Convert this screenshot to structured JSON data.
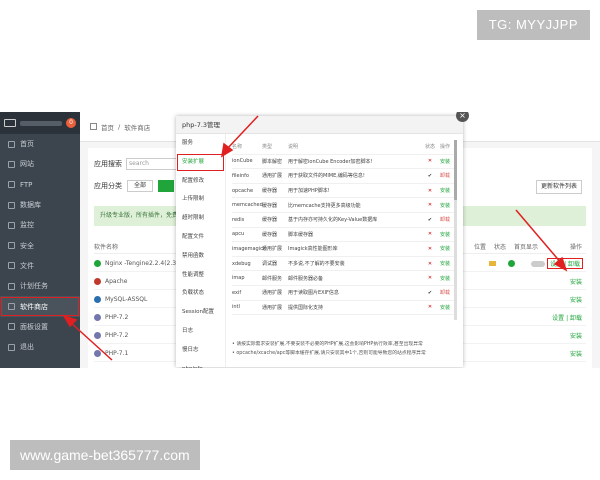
{
  "watermarks": {
    "top": "TG: MYYJJPP",
    "bottom": "www.game-bet365777.com"
  },
  "sidebar": {
    "badge": "0",
    "items": [
      {
        "label": "首页",
        "icon": "home-icon"
      },
      {
        "label": "网站",
        "icon": "globe-icon"
      },
      {
        "label": "FTP",
        "icon": "ftp-icon"
      },
      {
        "label": "数据库",
        "icon": "database-icon"
      },
      {
        "label": "监控",
        "icon": "monitor-icon"
      },
      {
        "label": "安全",
        "icon": "shield-icon"
      },
      {
        "label": "文件",
        "icon": "folder-icon"
      },
      {
        "label": "计划任务",
        "icon": "clock-icon"
      },
      {
        "label": "软件商店",
        "icon": "store-icon",
        "active": true
      },
      {
        "label": "面板设置",
        "icon": "gear-icon"
      },
      {
        "label": "退出",
        "icon": "logout-icon"
      }
    ]
  },
  "breadcrumb": {
    "home": "首页",
    "sep": "/",
    "current": "软件商店"
  },
  "store": {
    "search_label": "应用搜索",
    "search_placeholder": "search",
    "category_label": "应用分类",
    "all_button": "全部",
    "update_button": "更新软件列表",
    "notice": "升级专业版，所有插件，免费使用；",
    "headers": {
      "name": "软件名称",
      "location": "位置",
      "status": "状态",
      "home_display": "首页显示",
      "operation": "操作"
    },
    "rows": [
      {
        "name": "Nginx -Tengine2.2.4(2.3.1...)",
        "op": "设置 | 卸载",
        "color": "#20a53a"
      },
      {
        "name": "Apache",
        "op": "安装",
        "color": "#c0392b"
      },
      {
        "name": "MySQL-ASSQL",
        "op": "安装",
        "color": "#2a6fb0"
      },
      {
        "name": "PHP-7.2",
        "op": "设置 | 卸载",
        "color": "#7377ad"
      },
      {
        "name": "PHP-7.2",
        "op": "安装",
        "color": "#7377ad"
      },
      {
        "name": "PHP-7.1",
        "op": "安装",
        "color": "#7377ad"
      }
    ]
  },
  "dialog": {
    "title": "php-7.3管理",
    "close": "×",
    "menu": [
      "服务",
      "安装扩展",
      "配置修改",
      "上传限制",
      "超时限制",
      "配置文件",
      "禁用函数",
      "性能调整",
      "负载状态",
      "Session配置",
      "日志",
      "慢日志",
      "phpinfo"
    ],
    "menu_active": 1,
    "headers": {
      "name": "名称",
      "type": "类型",
      "desc": "说明",
      "status": "状态",
      "op": "操作"
    },
    "extensions": [
      {
        "name": "ionCube",
        "type": "脚本解密",
        "desc": "用于解密ionCube Encoder加密脚本!",
        "status": "✕",
        "op": "安装"
      },
      {
        "name": "fileinfo",
        "type": "通用扩展",
        "desc": "用于获取文件的MIME,编码等信息!",
        "status": "✔",
        "op": "卸载"
      },
      {
        "name": "opcache",
        "type": "缓存器",
        "desc": "用于加速PHP脚本!",
        "status": "✕",
        "op": "安装"
      },
      {
        "name": "memcached",
        "type": "缓存器",
        "desc": "比memcache支持更多高级功能",
        "status": "✕",
        "op": "安装"
      },
      {
        "name": "redis",
        "type": "缓存器",
        "desc": "基于内存亦可持久化的Key-Value数据库",
        "status": "✔",
        "op": "卸载"
      },
      {
        "name": "apcu",
        "type": "缓存器",
        "desc": "脚本缓存器",
        "status": "✕",
        "op": "安装"
      },
      {
        "name": "imagemagick",
        "type": "通用扩展",
        "desc": "Imagick高性能图形库",
        "status": "✕",
        "op": "安装"
      },
      {
        "name": "xdebug",
        "type": "调试器",
        "desc": "不多说,不了解的不要安装",
        "status": "✕",
        "op": "安装"
      },
      {
        "name": "imap",
        "type": "邮件服务",
        "desc": "邮件服务器必备",
        "status": "✕",
        "op": "安装"
      },
      {
        "name": "exif",
        "type": "通用扩展",
        "desc": "用于读取图片EXIF信息",
        "status": "✔",
        "op": "卸载"
      },
      {
        "name": "intl",
        "type": "通用扩展",
        "desc": "提供国际化支持",
        "status": "✕",
        "op": "安装"
      }
    ],
    "tips": [
      "请按实际需求安装扩展,不要安装不必要的PHP扩展,这会影响PHP执行效率,甚至出现异常",
      "opcache/xcache/apc等脚本缓存扩展,请只安装其中1个,否则可能导致您的站点程序异常"
    ]
  },
  "colors": {
    "accent": "#20a53a",
    "highlight": "#e02020",
    "sidebar": "#3c444d"
  }
}
